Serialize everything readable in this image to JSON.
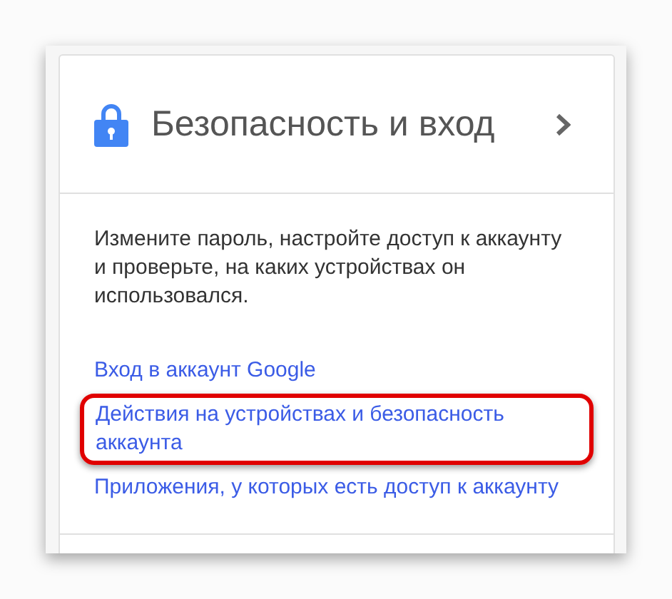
{
  "card": {
    "title": "Безопасность и вход",
    "description": "Измените пароль, настройте доступ к аккаунту и проверьте, на каких устройствах он использовался.",
    "links": [
      {
        "label": "Вход в аккаунт Google",
        "highlighted": false
      },
      {
        "label": "Действия на устройствах и безопасность аккаунта",
        "highlighted": true
      },
      {
        "label": "Приложения, у которых есть доступ к аккаунту",
        "highlighted": false
      }
    ]
  }
}
